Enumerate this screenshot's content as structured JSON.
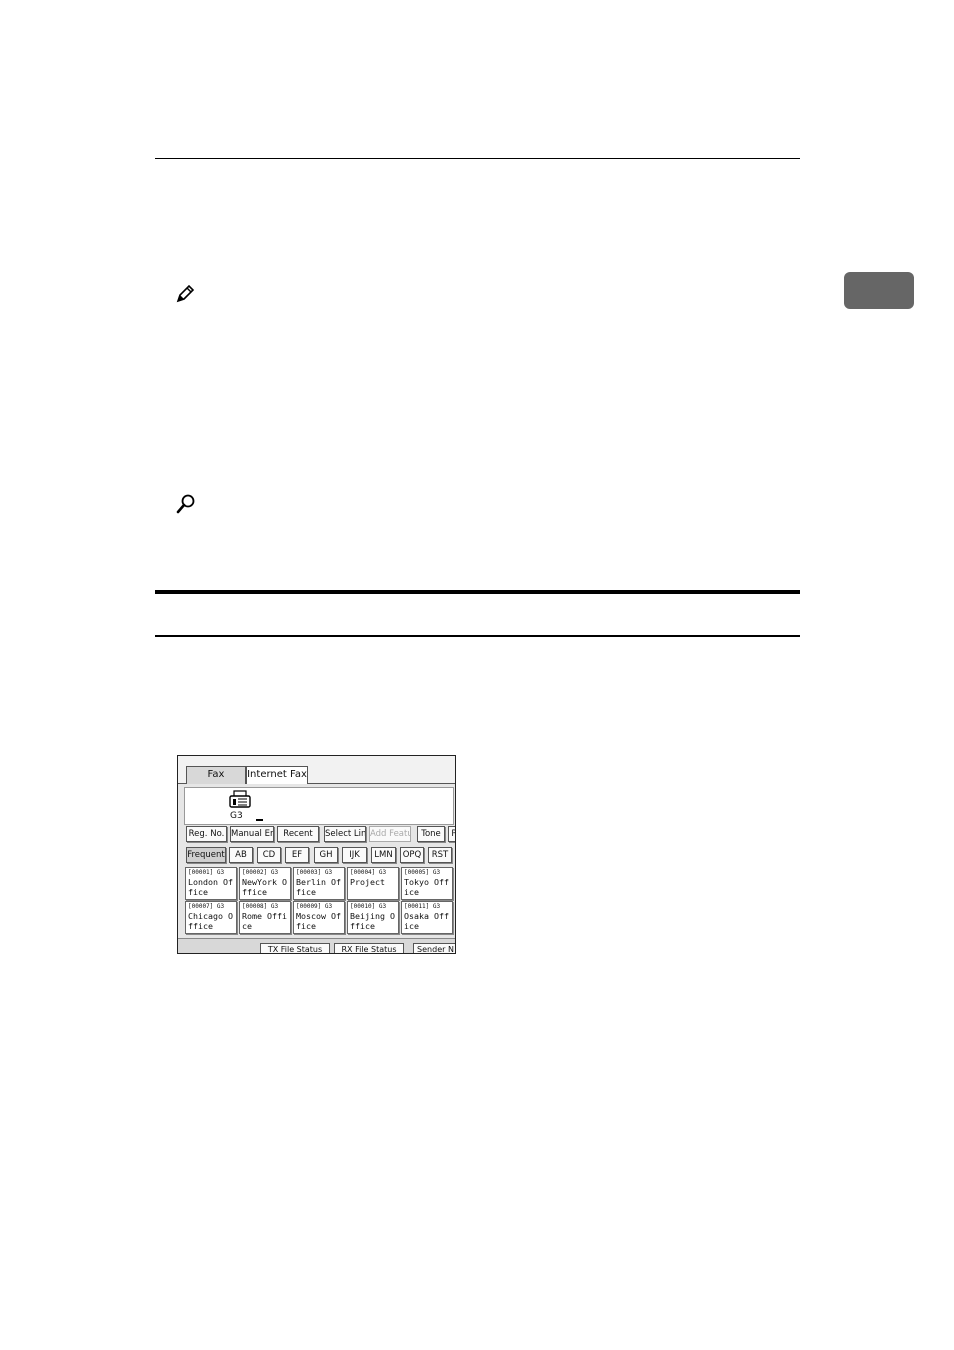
{
  "chapter_tab": {
    "label": ""
  },
  "fax_screen": {
    "tabs": [
      {
        "label": "Fax"
      },
      {
        "label": "Internet Fax"
      }
    ],
    "line_type": "G3",
    "toolbar": [
      {
        "label": "Reg. No."
      },
      {
        "label": "Manual Entry"
      },
      {
        "label": "Recent"
      },
      {
        "label": "Select Line"
      },
      {
        "label": "Add Feature"
      },
      {
        "label": "Tone"
      },
      {
        "label": "P"
      }
    ],
    "index_tabs": [
      {
        "label": "Frequent"
      },
      {
        "label": "AB"
      },
      {
        "label": "CD"
      },
      {
        "label": "EF"
      },
      {
        "label": "GH"
      },
      {
        "label": "IJK"
      },
      {
        "label": "LMN"
      },
      {
        "label": "OPQ"
      },
      {
        "label": "RST"
      }
    ],
    "destinations": [
      {
        "code": "[00001] G3",
        "name": "London Office"
      },
      {
        "code": "[00002] G3",
        "name": "NewYork Office"
      },
      {
        "code": "[00003] G3",
        "name": "Berlin Office"
      },
      {
        "code": "[00004] G3",
        "name": "Project"
      },
      {
        "code": "[00005] G3",
        "name": "Tokyo Office"
      },
      {
        "code": "[00007] G3",
        "name": "Chicago Office"
      },
      {
        "code": "[00008] G3",
        "name": "Rome Office"
      },
      {
        "code": "[00009] G3",
        "name": "Moscow Office"
      },
      {
        "code": "[00010] G3",
        "name": "Beijing Office"
      },
      {
        "code": "[00011] G3",
        "name": "Osaka Office"
      }
    ],
    "bottom_buttons": [
      {
        "label": "TX File Status"
      },
      {
        "label": "RX File Status"
      },
      {
        "label": "Sender N"
      }
    ]
  }
}
